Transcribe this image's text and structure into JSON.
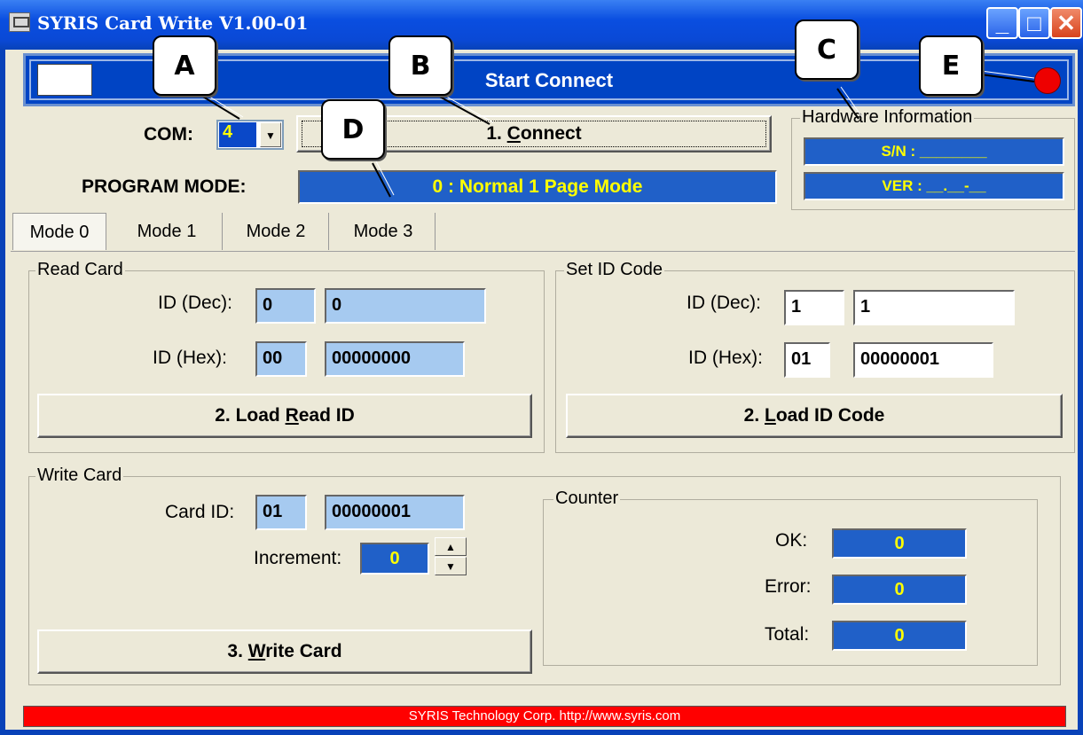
{
  "window": {
    "title": "SYRIS Card Write V1.00-01",
    "icon": "app-icon",
    "controls": [
      "minimize",
      "maximize",
      "close"
    ]
  },
  "status": {
    "text": "Start Connect",
    "led_color": "#ee0000"
  },
  "com": {
    "label": "COM:",
    "value": "4"
  },
  "connect_button": {
    "prefix": "1. ",
    "mnemonic": "C",
    "rest": "onnect"
  },
  "hardware": {
    "title": "Hardware Information",
    "sn": "S/N : ________",
    "ver": "VER : __.__-__"
  },
  "program_mode": {
    "label": "PROGRAM MODE:",
    "value": "0 : Normal 1 Page Mode"
  },
  "tabs": [
    "Mode 0",
    "Mode 1",
    "Mode 2",
    "Mode 3"
  ],
  "read_card": {
    "title": "Read Card",
    "id_dec_label": "ID (Dec):",
    "id_dec_1": "0",
    "id_dec_2": "0",
    "id_hex_label": "ID (Hex):",
    "id_hex_1": "00",
    "id_hex_2": "00000000",
    "button": {
      "prefix": "2. Load ",
      "mnemonic": "R",
      "rest": "ead ID"
    }
  },
  "set_id": {
    "title": "Set ID Code",
    "id_dec_label": "ID (Dec):",
    "id_dec_1": "1",
    "id_dec_2": "1",
    "id_hex_label": "ID (Hex):",
    "id_hex_1": "01",
    "id_hex_2": "00000001",
    "button": {
      "prefix": "2. ",
      "mnemonic": "L",
      "rest": "oad ID Code"
    }
  },
  "write_card": {
    "title": "Write Card",
    "card_id_label": "Card ID:",
    "card_id_1": "01",
    "card_id_2": "00000001",
    "increment_label": "Increment:",
    "increment_value": "0",
    "button": {
      "prefix": "3. ",
      "mnemonic": "W",
      "rest": "rite Card"
    }
  },
  "counter": {
    "title": "Counter",
    "ok_label": "OK:",
    "ok_value": "0",
    "error_label": "Error:",
    "error_value": "0",
    "total_label": "Total:",
    "total_value": "0"
  },
  "footer": {
    "text": "SYRIS Technology Corp.   http://www.syris.com"
  },
  "callouts": {
    "a": "A",
    "b": "B",
    "c": "C",
    "d": "D",
    "e": "E"
  }
}
